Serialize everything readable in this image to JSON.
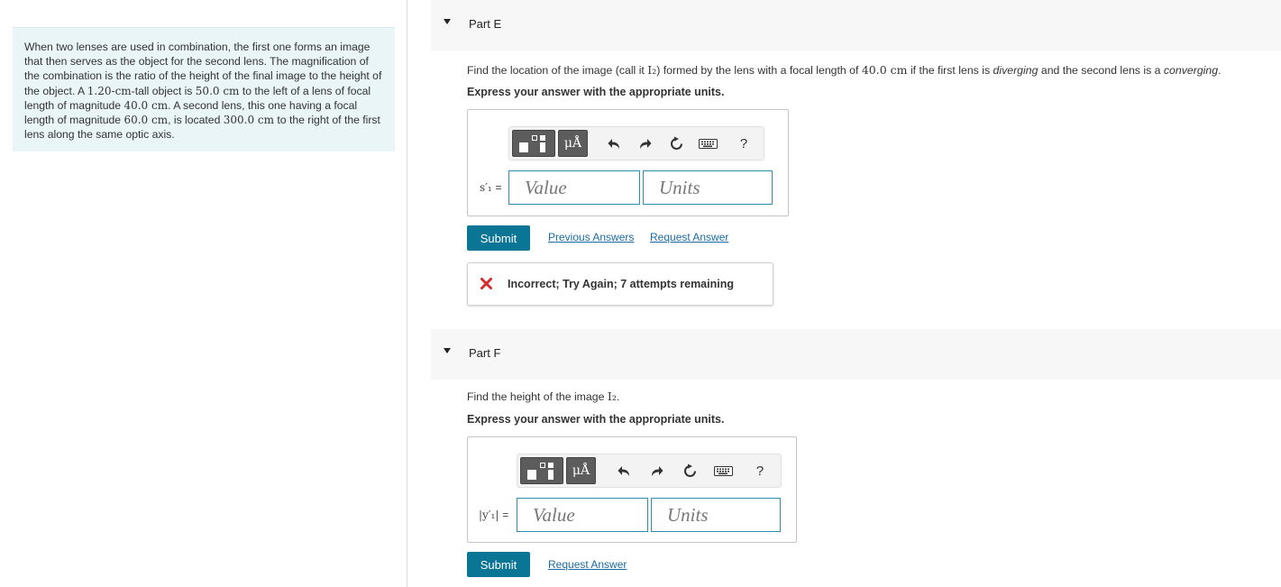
{
  "problem": {
    "intro": "When two lenses are used in combination, the first one forms an image that then serves as the object for the second lens. The magnification of the combination is the ratio of the height of the final image to the height of the object. A ",
    "object_height": "1.20-cm",
    "t1": "-tall object is ",
    "distance": "50.0 cm",
    "t2": " to the left of a lens of focal length of magnitude ",
    "f1": "40.0 cm",
    "t3": ". A second lens, this one having a focal length of magnitude ",
    "f2": "60.0 cm",
    "t4": ", is located ",
    "separation": "300.0 cm",
    "t5": " to the right of the first lens along the same optic axis."
  },
  "part_e": {
    "title": "Part E",
    "question": {
      "a": "Find the location of the image (call it ",
      "img_symbol": "I₂",
      "b": ") formed by the lens with a focal length of ",
      "focal": "40.0 cm",
      "c": " if the first lens is ",
      "diverging": "diverging",
      "d": " and the second lens is a ",
      "converging": "converging",
      "e": "."
    },
    "instruction": "Express your answer with the appropriate units.",
    "toolbar": {
      "units_symbol": "μÅ",
      "help_symbol": "?"
    },
    "variable": "s′₁",
    "equals": "=",
    "value_placeholder": "Value",
    "units_placeholder": "Units",
    "submit_label": "Submit",
    "previous_answers_label": "Previous Answers",
    "request_answer_label": "Request Answer",
    "feedback_text": "Incorrect; Try Again; 7 attempts remaining"
  },
  "part_f": {
    "title": "Part F",
    "question": {
      "a": "Find the height of the image ",
      "img_symbol": "I₂",
      "b": "."
    },
    "instruction": "Express your answer with the appropriate units.",
    "toolbar": {
      "units_symbol": "μÅ",
      "help_symbol": "?"
    },
    "variable": "|y′₁|",
    "equals": "=",
    "value_placeholder": "Value",
    "units_placeholder": "Units",
    "submit_label": "Submit",
    "request_answer_label": "Request Answer"
  },
  "colors": {
    "accent": "#0b7595",
    "link": "#1a6aa5",
    "input_border": "#2d8fae",
    "problem_bg": "#e9f5f7",
    "error": "#d22c2c"
  }
}
